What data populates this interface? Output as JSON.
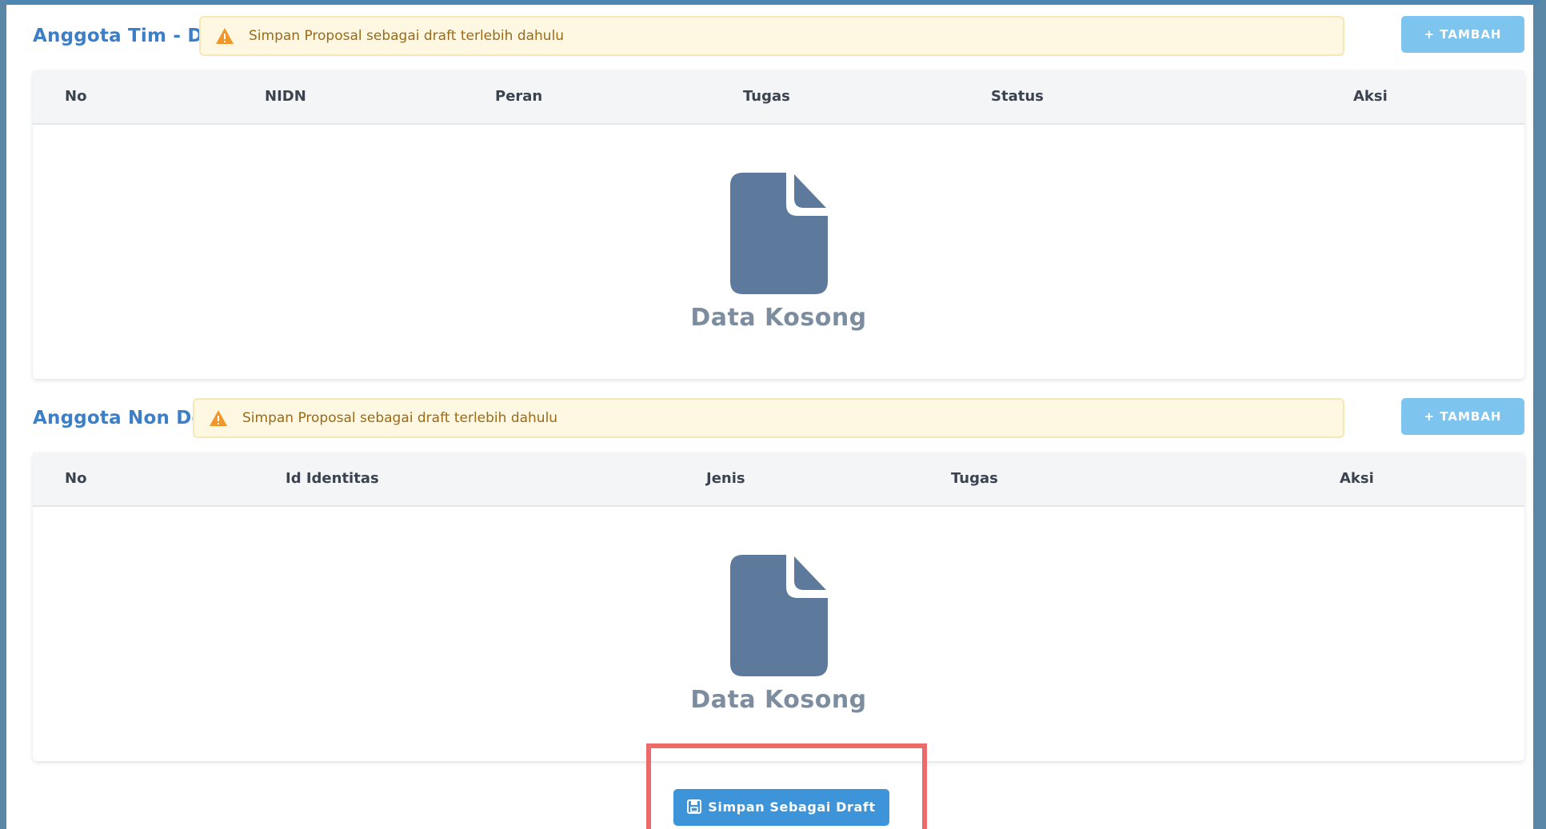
{
  "sections": {
    "dosen": {
      "title": "Anggota Tim - Dosen",
      "alert": "Simpan Proposal sebagai draft terlebih dahulu",
      "add_button": "+ TAMBAH",
      "columns": [
        "No",
        "NIDN",
        "Peran",
        "Tugas",
        "Status",
        "Aksi"
      ],
      "empty_text": "Data Kosong"
    },
    "non_dosen": {
      "title": "Anggota Non Dosen",
      "alert": "Simpan Proposal sebagai draft terlebih dahulu",
      "add_button": "+ TAMBAH",
      "columns": [
        "No",
        "Id Identitas",
        "Jenis",
        "Tugas",
        "Aksi"
      ],
      "empty_text": "Data Kosong"
    }
  },
  "footer": {
    "save_draft_label": "Simpan Sebagai Draft"
  },
  "icons": {
    "alert": "warning-triangle-icon",
    "empty": "document-icon",
    "save": "save-icon"
  },
  "colors": {
    "accent": "#3c7fc7",
    "button_light": "#7dc5ee",
    "button_primary": "#3d94d9",
    "alert_bg": "#fef8e3",
    "alert_text": "#9a6a19",
    "empty_icon": "#5d7a9d",
    "highlight": "#ec6a6a"
  }
}
